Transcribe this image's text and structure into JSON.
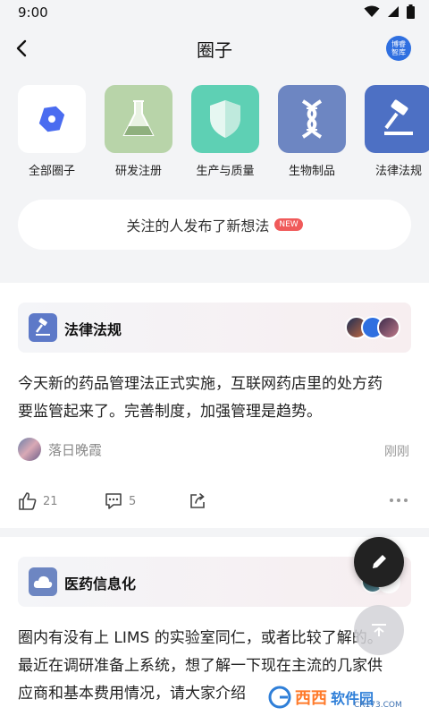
{
  "status": {
    "time": "9:00"
  },
  "header": {
    "title": "圈子",
    "logo_line1": "博睿",
    "logo_line2": "智库"
  },
  "categories": [
    {
      "label": "全部圈子",
      "icon": "circle-dot-icon"
    },
    {
      "label": "研发注册",
      "icon": "flask-icon"
    },
    {
      "label": "生产与质量",
      "icon": "shield-icon"
    },
    {
      "label": "生物制品",
      "icon": "dna-icon"
    },
    {
      "label": "法律法规",
      "icon": "gavel-icon"
    }
  ],
  "notice": {
    "text": "关注的人发布了新想法",
    "badge": "NEW"
  },
  "posts": [
    {
      "circle": "法律法规",
      "circle_icon": "gavel-icon",
      "content_line1": "今天新的药品管理法正式实施，互联网药店里的处方药",
      "content_line2": "要监管起来了。完善制度，加强管理是趋势。",
      "author": "落日晚霞",
      "time": "刚刚",
      "likes": "21",
      "comments": "5"
    },
    {
      "circle": "医药信息化",
      "circle_icon": "cloud-icon",
      "content_line1": "圈内有没有上 LIMS 的实验室同仁，或者比较了解的。",
      "content_line2": "最近在调研准备上系统，想了解一下现在主流的几家供",
      "content_line3": "应商和基本费用情况，请大家介绍"
    }
  ],
  "watermark": {
    "main": "西西",
    "cn": "软件园",
    "url": "CR173.COM"
  },
  "colors": {
    "accent": "#5d79c8",
    "badge": "#f05a5a",
    "fab": "#222222"
  }
}
